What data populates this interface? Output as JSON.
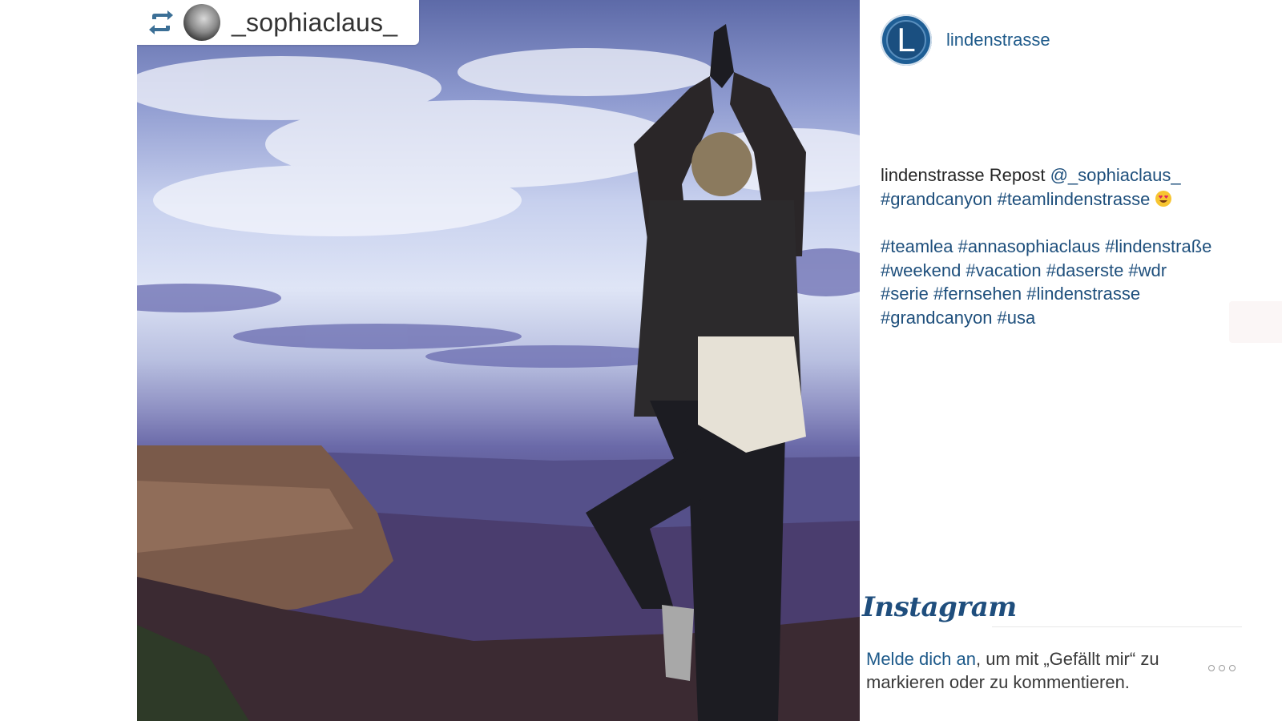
{
  "repost": {
    "username": "_sophiaclaus_",
    "icon": "repost-icon"
  },
  "post": {
    "author": "lindenstrasse",
    "logo_letter": "L",
    "caption": {
      "user": "lindenstrasse",
      "text": " Repost ",
      "mention": "@_sophiaclaus_",
      "line2_tags": [
        "#grandcanyon",
        "#teamlindenstrasse"
      ],
      "emoji": "heart-eyes-emoji",
      "tag_lines": [
        "#teamlea #annasophiaclaus #lindenstraße",
        "#weekend #vacation #daserste #wdr",
        "#serie #fernsehen #lindenstrasse",
        "#grandcanyon #usa"
      ]
    }
  },
  "footer": {
    "brand": "Instagram",
    "login_link": "Melde dich an",
    "login_rest": ", um mit „Gefällt mir“ zu markieren oder zu kommentieren.",
    "more_icon": "more-dots-icon"
  },
  "colors": {
    "link": "#1e5a8a",
    "tag": "#1e4f7c",
    "logo": "#1e5e95"
  }
}
